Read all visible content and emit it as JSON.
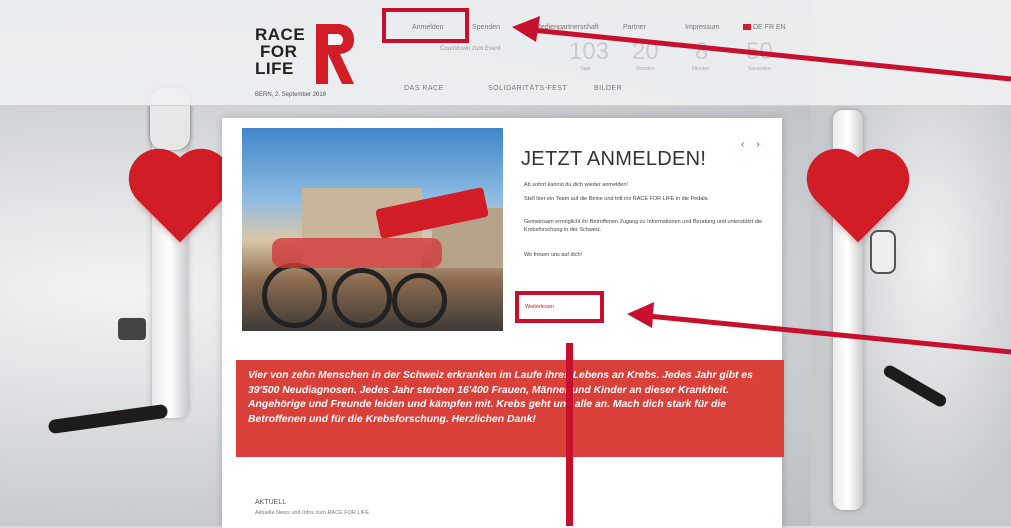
{
  "brand": {
    "line1": "RACE",
    "line2": "FOR",
    "line3": "LIFE",
    "date": "BERN, 2. September 2018",
    "accent_color": "#d21d26"
  },
  "topnav": {
    "items": [
      "Anmelden",
      "Spenden",
      "Medienpartnerschaft",
      "Partner",
      "Impressum"
    ],
    "lang": "DE FR EN"
  },
  "countdown": {
    "label": "Countdown zum Event",
    "values": [
      "103",
      "20",
      "8",
      "50"
    ],
    "units": [
      "Tage",
      "Stunden",
      "Minuten",
      "Sekunden"
    ]
  },
  "mainnav": {
    "items": [
      "DAS RACE",
      "SOLIDARITÄTS-FEST",
      "BILDER"
    ]
  },
  "slide": {
    "headline": "JETZT ANMELDEN!",
    "p1": "Ab sofort kannst du dich wieder anmelden!",
    "p2": "Stell hier ein Team auf die Beine und tritt ins RACE FOR LIFE in die Pedale.",
    "p3": "Gemeinsam ermöglicht ihr Betroffenen Zugang zu Informationen und Beratung und unterstützt die Krebsforschung in der Schweiz.",
    "p4": "Wir freuen uns auf dich!",
    "link": "Weiterlesen",
    "prev": "‹",
    "next": "›"
  },
  "banner": "Vier von zehn Menschen in der Schweiz erkranken im Laufe ihres Lebens an Krebs. Jedes Jahr gibt es 39'500 Neudiagnosen. Jedes Jahr sterben 16'400 Frauen, Männer und Kinder an dieser Krankheit. Angehörige und Freunde leiden und kämpfen mit. Krebs geht uns alle an. Mach dich stark für die Betroffenen und für die Krebsforschung. Herzlichen Dank!",
  "news": {
    "title": "AKTUELL",
    "subtitle": "Aktuelle News und Infos zum RACE FOR LIFE"
  },
  "annotation_color": "#c8102e"
}
